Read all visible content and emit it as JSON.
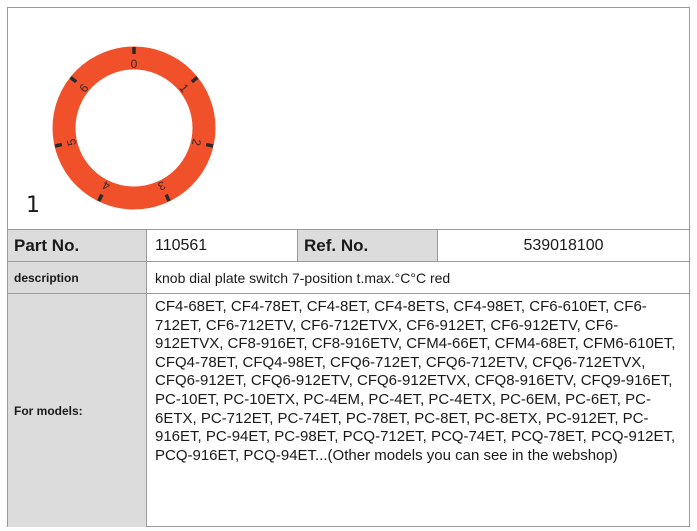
{
  "figure": {
    "number": "1",
    "dial_labels": [
      "0",
      "1",
      "2",
      "3",
      "4",
      "5",
      "6"
    ],
    "dial_color": "#f0502a"
  },
  "part": {
    "label": "Part No.",
    "value": "110561"
  },
  "ref": {
    "label": "Ref. No.",
    "value": "539018100"
  },
  "description": {
    "label": "description",
    "value": "knob dial plate  switch 7-position t.max.°C°C red"
  },
  "models": {
    "label": "For models:",
    "value": "CF4-68ET, CF4-78ET, CF4-8ET, CF4-8ETS, CF4-98ET, CF6-610ET, CF6-712ET, CF6-712ETV, CF6-712ETVX, CF6-912ET, CF6-912ETV, CF6-912ETVX, CF8-916ET, CF8-916ETV, CFM4-66ET, CFM4-68ET, CFM6-610ET, CFQ4-78ET, CFQ4-98ET, CFQ6-712ET, CFQ6-712ETV, CFQ6-712ETVX, CFQ6-912ET, CFQ6-912ETV, CFQ6-912ETVX, CFQ8-916ETV, CFQ9-916ET, PC-10ET, PC-10ETX, PC-4EM, PC-4ET, PC-4ETX, PC-6EM, PC-6ET, PC-6ETX, PC-712ET, PC-74ET, PC-78ET, PC-8ET, PC-8ETX, PC-912ET, PC-916ET, PC-94ET, PC-98ET, PCQ-712ET, PCQ-74ET, PCQ-78ET, PCQ-912ET, PCQ-916ET, PCQ-94ET...(Other models you can see in the webshop)"
  }
}
